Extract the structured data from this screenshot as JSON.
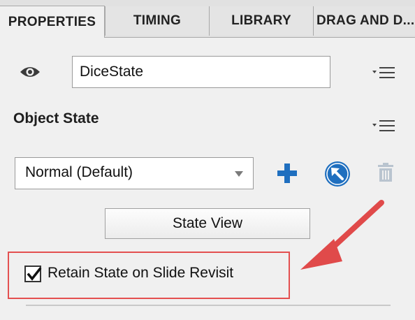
{
  "tabs": [
    {
      "label": "PROPERTIES",
      "active": true
    },
    {
      "label": "TIMING",
      "active": false
    },
    {
      "label": "LIBRARY",
      "active": false
    },
    {
      "label": "DRAG AND D...",
      "active": false
    }
  ],
  "object": {
    "name_value": "DiceState"
  },
  "object_state": {
    "title": "Object State",
    "selected_state": "Normal (Default)"
  },
  "buttons": {
    "state_view": "State View"
  },
  "retain_state": {
    "label": "Retain State on Slide Revisit",
    "checked": true
  },
  "icons": {
    "visibility": "eye-icon",
    "panel_menu": "menu-lines-icon",
    "add_state": "plus-icon",
    "reset_state": "arrow-circle-icon",
    "delete_state": "trash-icon"
  },
  "colors": {
    "accent_blue": "#1f6fbf",
    "annotation_red": "#e04a4a"
  }
}
